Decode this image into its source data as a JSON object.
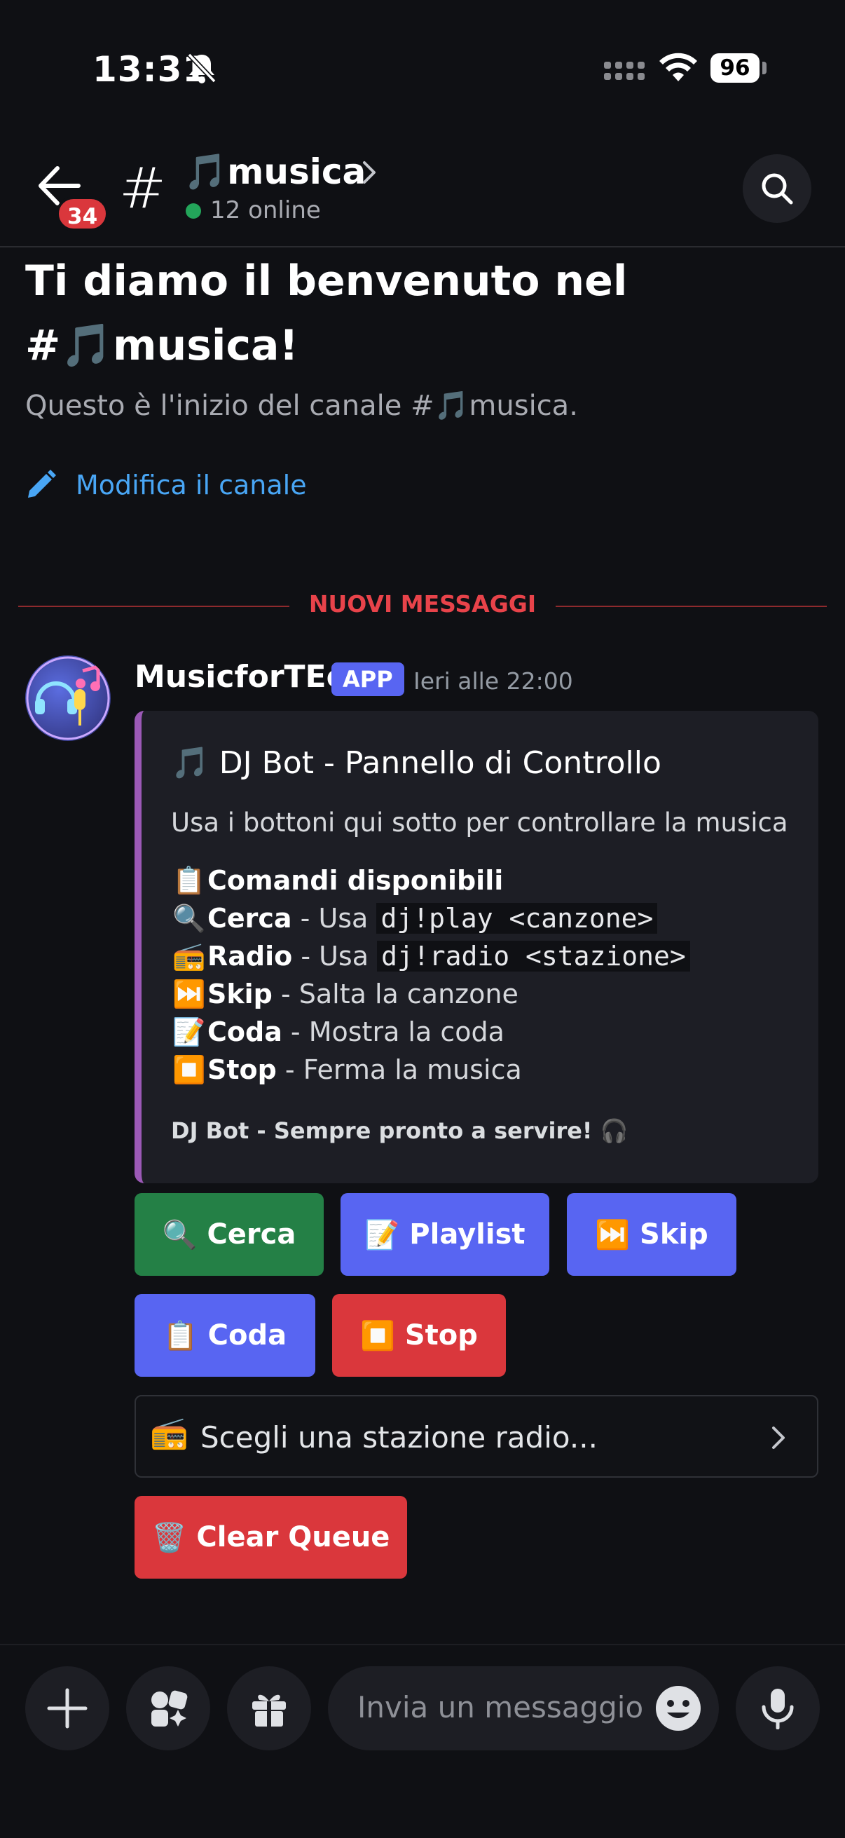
{
  "status_bar": {
    "time": "13:31",
    "battery": "96"
  },
  "header": {
    "unread_count": "34",
    "channel_name": "🎵musica",
    "online": "12 online"
  },
  "welcome": {
    "title": "Ti diamo il benvenuto nel #🎵musica!",
    "subtitle": "Questo è l'inizio del canale #🎵musica.",
    "edit_label": "Modifica il canale"
  },
  "divider": {
    "label": "NUOVI MESSAGGI"
  },
  "message": {
    "author": "MusicforTEo",
    "tag": "APP",
    "timestamp": "Ieri alle 22:00",
    "embed": {
      "title": "🎵 DJ Bot - Pannello di Controllo",
      "description": "Usa i bottoni qui sotto per controllare la musica",
      "field_icon": "📋",
      "field_name": "Comandi disponibili",
      "lines": [
        {
          "icon": "🔍",
          "name": "Cerca",
          "text": " - Usa ",
          "code": "dj!play <canzone>"
        },
        {
          "icon": "📻",
          "name": "Radio",
          "text": " - Usa ",
          "code": "dj!radio <stazione>"
        },
        {
          "icon": "⏭️",
          "name": "Skip",
          "text": " - Salta la canzone",
          "code": ""
        },
        {
          "icon": "📝",
          "name": "Coda",
          "text": " - Mostra la coda",
          "code": ""
        },
        {
          "icon": "⏹️",
          "name": "Stop",
          "text": " - Ferma la musica",
          "code": ""
        }
      ],
      "footer": "DJ Bot - Sempre pronto a servire! 🎧"
    },
    "buttons": {
      "cerca": {
        "icon": "🔍",
        "label": "Cerca"
      },
      "playlist": {
        "icon": "📝",
        "label": "Playlist"
      },
      "skip": {
        "icon": "⏭️",
        "label": "Skip"
      },
      "coda": {
        "icon": "📋",
        "label": "Coda"
      },
      "stop": {
        "icon": "⏹️",
        "label": "Stop"
      },
      "clear": {
        "icon": "🗑️",
        "label": "Clear Queue"
      }
    },
    "select": {
      "icon": "📻",
      "placeholder": "Scegli una stazione radio..."
    }
  },
  "composer": {
    "placeholder": "Invia un messaggio..."
  },
  "colors": {
    "background": "#0f1014",
    "accent_blue": "#5865f2",
    "success_green": "#248046",
    "danger_red": "#da373c",
    "embed_border": "#9b59b6",
    "link": "#49a6f5"
  }
}
